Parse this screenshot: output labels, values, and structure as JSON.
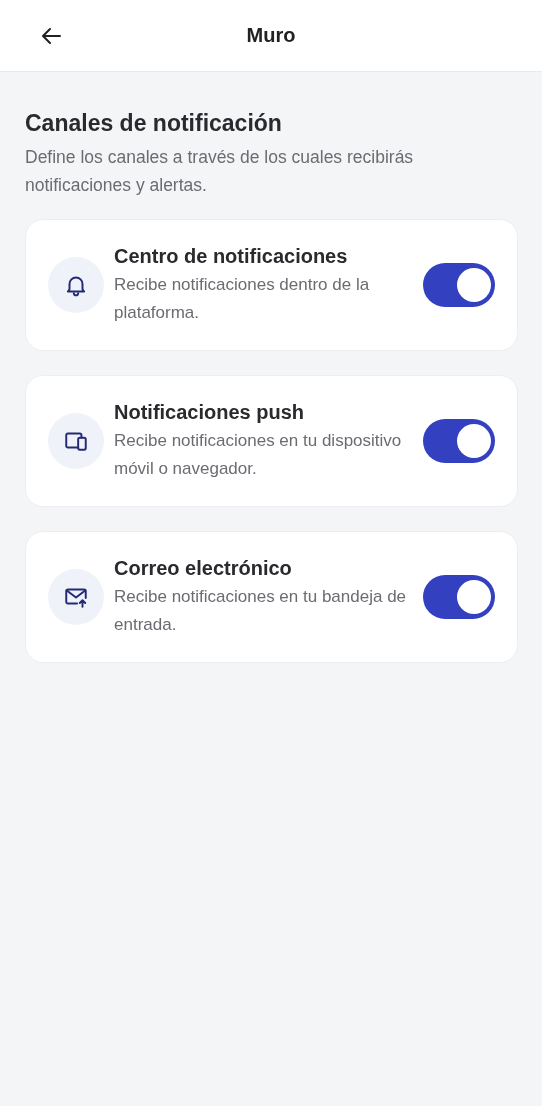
{
  "header": {
    "title": "Muro"
  },
  "section": {
    "title": "Canales de notificación",
    "description": "Define los canales a través de los cuales recibirás notificaciones y alertas."
  },
  "channels": [
    {
      "kind": "bell",
      "title": "Centro de notificaciones",
      "description": "Recibe notificaciones dentro de la plataforma.",
      "on": true
    },
    {
      "kind": "devices",
      "title": "Notificaciones push",
      "description": "Recibe notificaciones en tu dispositivo móvil o navegador.",
      "on": true
    },
    {
      "kind": "mail",
      "title": "Correo electrónico",
      "description": "Recibe notificaciones en tu bandeja de entrada.",
      "on": true
    }
  ]
}
